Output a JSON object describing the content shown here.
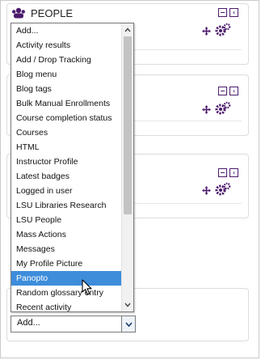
{
  "block": {
    "title": "PEOPLE"
  },
  "dropdown": {
    "options": [
      "Add...",
      "Activity results",
      "Add / Drop Tracking",
      "Blog menu",
      "Blog tags",
      "Bulk Manual Enrollments",
      "Course completion status",
      "Courses",
      "HTML",
      "Instructor Profile",
      "Latest badges",
      "Logged in user",
      "LSU Libraries Research",
      "LSU People",
      "Mass Actions",
      "Messages",
      "My Profile Picture",
      "Panopto",
      "Random glossary entry",
      "Recent activity"
    ],
    "highlighted": "Panopto"
  },
  "select": {
    "value": "Add..."
  },
  "colors": {
    "accent": "#4b1a6b",
    "highlight": "#3d8ddb"
  }
}
